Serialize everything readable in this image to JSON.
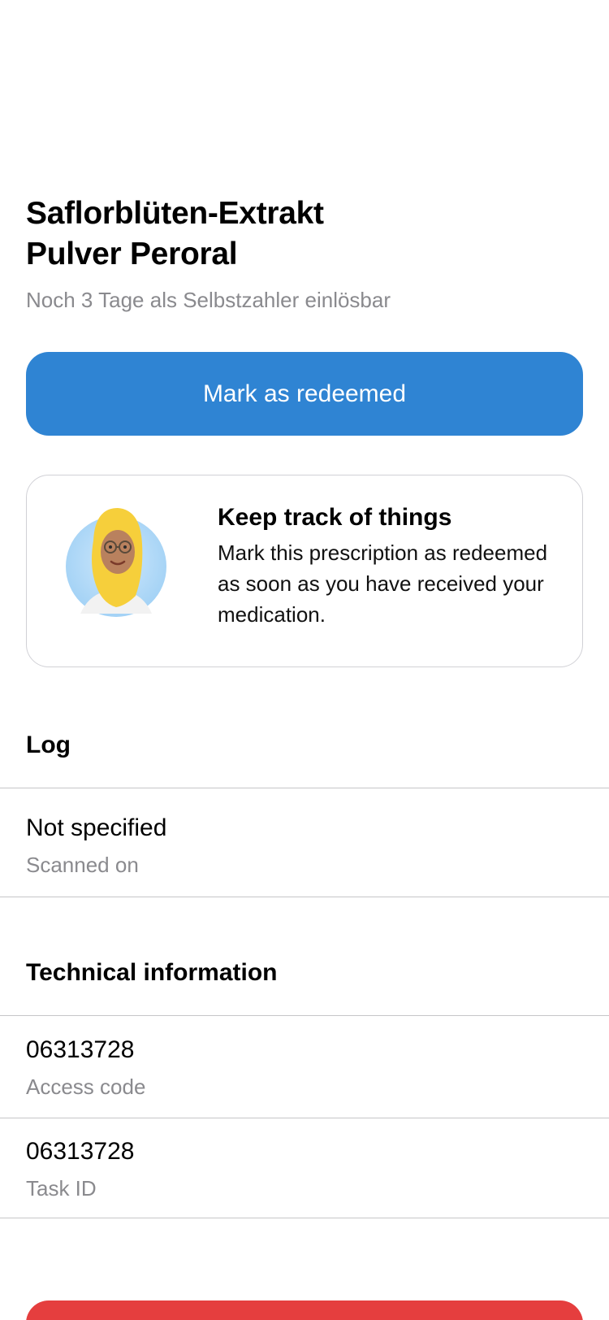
{
  "header": {
    "title_line1": "Saflorblüten-Extrakt",
    "title_line2": "Pulver Peroral",
    "subtitle": "Noch 3 Tage als Selbstzahler einlösbar"
  },
  "actions": {
    "mark_redeemed_label": "Mark as redeemed"
  },
  "hint": {
    "title": "Keep track of things",
    "body": "Mark this prescription as redeemed as soon as you have received your medication."
  },
  "log": {
    "header": "Log",
    "items": [
      {
        "value": "Not specified",
        "label": "Scanned on"
      }
    ]
  },
  "technical": {
    "header": "Technical information",
    "items": [
      {
        "value": "06313728",
        "label": "Access code"
      },
      {
        "value": "06313728",
        "label": "Task ID"
      }
    ]
  },
  "colors": {
    "primary": "#2f84d3",
    "danger": "#e53e3e",
    "secondary_text": "#8a8a8e",
    "divider": "#c6c6c8"
  }
}
